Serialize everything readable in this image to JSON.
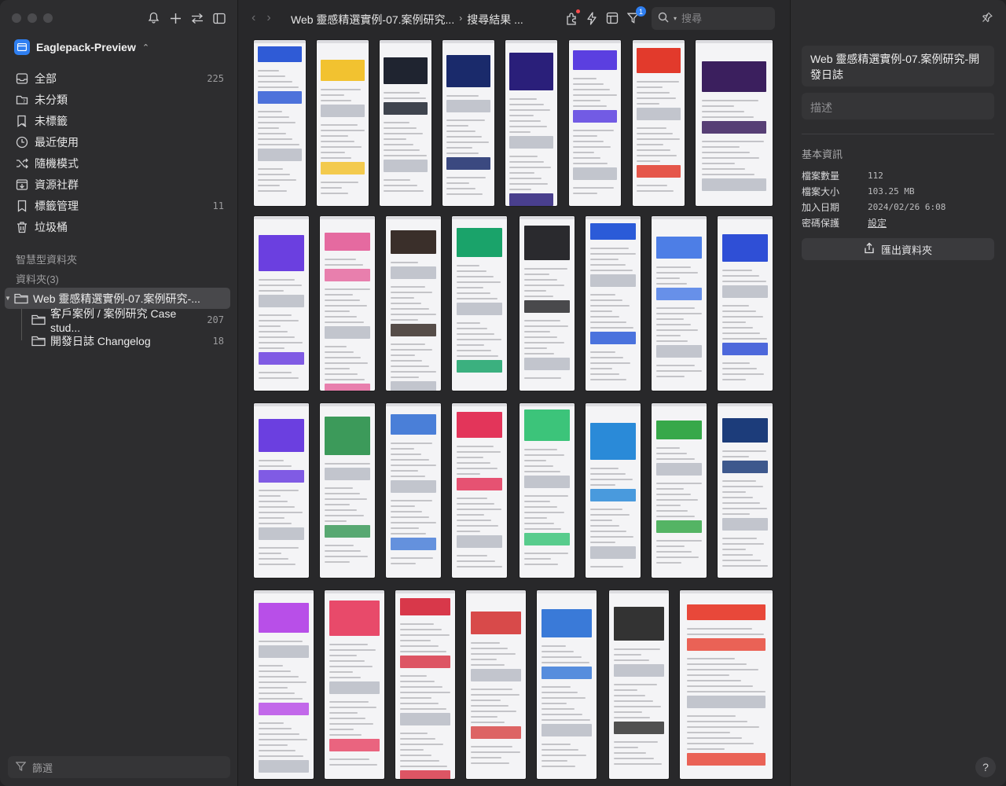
{
  "sidebar": {
    "library_name": "Eaglepack-Preview",
    "nav": [
      {
        "label": "全部",
        "count": "225",
        "icon": "inbox-icon"
      },
      {
        "label": "未分類",
        "count": "",
        "icon": "folder-question-icon"
      },
      {
        "label": "未標籤",
        "count": "",
        "icon": "tag-off-icon"
      },
      {
        "label": "最近使用",
        "count": "",
        "icon": "clock-icon"
      },
      {
        "label": "隨機模式",
        "count": "",
        "icon": "shuffle-icon"
      },
      {
        "label": "資源社群",
        "count": "",
        "icon": "download-box-icon"
      },
      {
        "label": "標籤管理",
        "count": "11",
        "icon": "bookmark-icon"
      },
      {
        "label": "垃圾桶",
        "count": "",
        "icon": "trash-icon"
      }
    ],
    "smart_folders_title": "智慧型資料夾",
    "folders_title": "資料夾(3)",
    "folders": [
      {
        "label": "Web 靈感精選實例-07.案例研究-...",
        "count": ""
      },
      {
        "label": "客戶案例 / 案例研究 Case stud...",
        "count": "207"
      },
      {
        "label": "開發日誌 Changelog",
        "count": "18"
      }
    ],
    "filter_placeholder": "篩選"
  },
  "toolbar": {
    "breadcrumb_folder": "Web 靈感精選實例-07.案例研究...",
    "breadcrumb_current": "搜尋結果 ...",
    "filter_badge": "1",
    "search_placeholder": "搜尋"
  },
  "inspector": {
    "title": "Web 靈感精選實例-07.案例研究-開發日誌",
    "description_placeholder": "描述",
    "info_title": "基本資訊",
    "rows": [
      {
        "key": "檔案數量",
        "value": "112"
      },
      {
        "key": "檔案大小",
        "value": "103.25 MB"
      },
      {
        "key": "加入日期",
        "value": "2024/02/26 6:08"
      },
      {
        "key": "密碼保護",
        "value": "設定"
      }
    ],
    "export_label": "匯出資料夾"
  },
  "thumbnails": [
    {
      "accent": "#2f5bd6"
    },
    {
      "accent": "#f2c230"
    },
    {
      "accent": "#1f2430"
    },
    {
      "accent": "#1a2a6b"
    },
    {
      "accent": "#2a1f7a"
    },
    {
      "accent": "#5b3fe0"
    },
    {
      "accent": "#e23a2c"
    },
    {
      "accent": "#3b1f5e"
    },
    {
      "accent": "#6b3fe0"
    },
    {
      "accent": "#e56aa0"
    },
    {
      "accent": "#3a2f2a"
    },
    {
      "accent": "#1aa36a"
    },
    {
      "accent": "#2a2a2e"
    },
    {
      "accent": "#2b5bd8"
    },
    {
      "accent": "#4d7ee6"
    },
    {
      "accent": "#2f4fd6"
    },
    {
      "accent": "#6b3fe0"
    },
    {
      "accent": "#3c9a5a"
    },
    {
      "accent": "#4a7fd8"
    },
    {
      "accent": "#e3355a"
    },
    {
      "accent": "#3cc47a"
    },
    {
      "accent": "#2a8ad8"
    },
    {
      "accent": "#37a84a"
    },
    {
      "accent": "#1c3c7a"
    },
    {
      "accent": "#b84fe8"
    },
    {
      "accent": "#e84a6a"
    },
    {
      "accent": "#d8384a"
    },
    {
      "accent": "#d84a4a"
    },
    {
      "accent": "#3a7ad8"
    },
    {
      "accent": "#333333"
    },
    {
      "accent": "#e8483a"
    }
  ]
}
